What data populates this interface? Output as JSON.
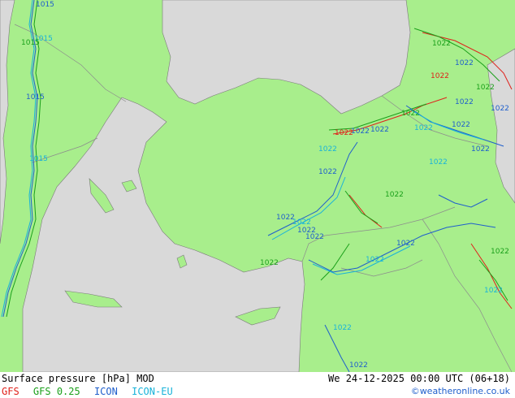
{
  "title": "Surface pressure [hPa] MOD",
  "valid_time": "We 24-12-2025 00:00 UTC (06+18)",
  "credit": "©weatheronline.co.uk",
  "legend": [
    {
      "label": "GFS",
      "color": "#e0201a"
    },
    {
      "label": "GFS 0.25",
      "color": "#1aa01a"
    },
    {
      "label": "ICON",
      "color": "#1f5fcc"
    },
    {
      "label": "ICON-EU",
      "color": "#19b3d9"
    }
  ],
  "colors": {
    "land": "#a8ee8c",
    "sea": "#d9d9d9",
    "border": "#888888"
  },
  "isobar_labels": {
    "l1015a": "1015",
    "l1015b": "1015",
    "l1015c": "1015",
    "l1015d": "1015",
    "l1015e": "1015",
    "l1022_caucasus1": "1022",
    "l1022_caucasus2": "1022",
    "l1022_caucasus3": "1022",
    "l1022_caucasus4": "1022",
    "l1022_east1": "1022",
    "l1022_east2": "1022",
    "l1022_east3": "1022",
    "l1022_east4": "1022",
    "l1022_east5": "1022",
    "l1022_east6": "1022",
    "l1022_east7": "1022",
    "l1022_anat1": "1022",
    "l1022_anat2": "1022",
    "l1022_anat3": "1022",
    "l1022_anat4": "1022",
    "l1022_anat5": "1022",
    "l1022_anat6": "1022",
    "l1022_anat7": "1022",
    "l1022_south1": "1022",
    "l1022_south2": "1022",
    "l1022_south3": "1022",
    "l1022_south4": "1022",
    "l1022_south5": "1022",
    "l1022_south6": "1022",
    "l1022_syria1": "1022",
    "l1022_syria2": "1022",
    "l1022_syria3": "1022",
    "l1022_syria4": "1022"
  }
}
